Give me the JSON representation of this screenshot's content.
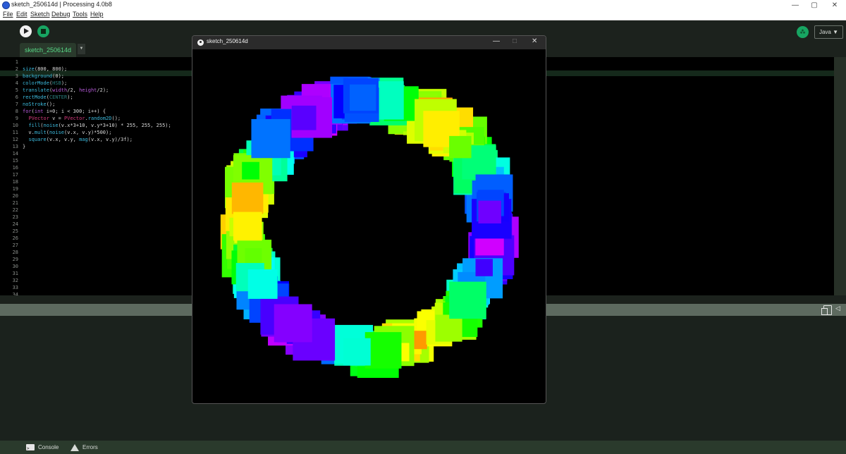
{
  "window": {
    "title": "sketch_250614d | Processing 4.0b8",
    "minimize": "—",
    "maximize": "▢",
    "close": "✕"
  },
  "menu": {
    "items": [
      "File",
      "Edit",
      "Sketch",
      "Debug",
      "Tools",
      "Help"
    ]
  },
  "toolbar": {
    "mode_label": "Java ▼"
  },
  "tabs": {
    "active_label": "sketch_250614d",
    "menu_arrow": "▼"
  },
  "editor": {
    "line_numbers": [
      "1",
      "2",
      "3",
      "4",
      "5",
      "6",
      "7",
      "8",
      "9",
      "10",
      "11",
      "12",
      "13",
      "14",
      "15",
      "16",
      "17",
      "18",
      "19",
      "20",
      "21",
      "22",
      "23",
      "24",
      "25",
      "26",
      "27",
      "28",
      "29",
      "30",
      "31",
      "32",
      "33",
      "34"
    ],
    "highlighted_line": 3,
    "code_lines": [
      "",
      "size(800, 800);",
      "background(0);",
      "colorMode(HSB);",
      "translate(width/2, height/2);",
      "rectMode(CENTER);",
      "noStroke();",
      "for(int i=0; i < 300; i++) {",
      "  PVector v = PVector.random2D();",
      "  fill(noise(v.x*3+10, v.y*3+10) * 255, 255, 255);",
      "  v.mult(noise(v.x, v.y)*500);",
      "  square(v.x, v.y, mag(v.x, v.y)/3f);",
      "}"
    ]
  },
  "console_tabs": {
    "console_label": "Console",
    "errors_label": "Errors"
  },
  "sketch_window": {
    "title": "sketch_250614d",
    "minimize": "—",
    "maximize": "□",
    "close": "✕"
  },
  "icons": {
    "run": "play-icon",
    "stop": "stop-icon",
    "debug": "debug-icon",
    "copy": "copy-icon",
    "collapse": "arrow-left-icon",
    "console": "console-icon",
    "errors": "warning-icon"
  },
  "colors": {
    "accent": "#17a562",
    "tab_text": "#58d987",
    "editor_bg": "#000000",
    "ide_bg": "#1c221d"
  }
}
